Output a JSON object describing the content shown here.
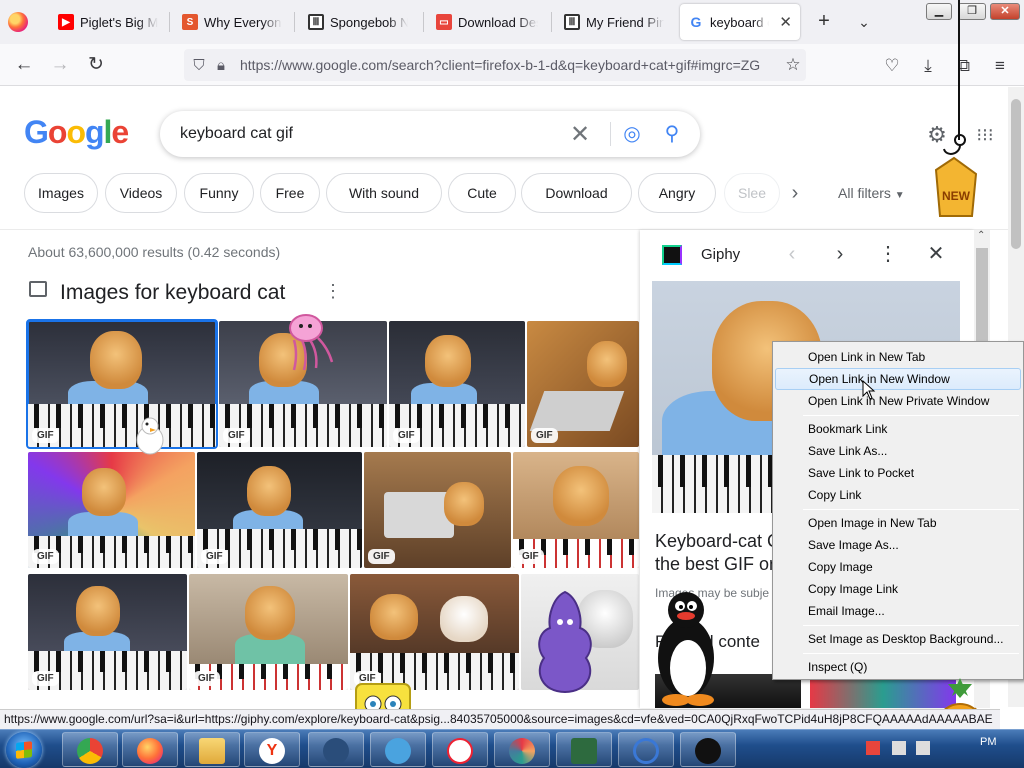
{
  "browser": {
    "tabs": [
      {
        "title": "Piglet's Big Mo",
        "favicon": "youtube-icon",
        "color": "#ff0000"
      },
      {
        "title": "Why Everyone S",
        "favicon": "s-icon",
        "color": "#e4572e"
      },
      {
        "title": "Spongebob Nic",
        "favicon": "museum-icon",
        "color": "#333333"
      },
      {
        "title": "Download Desk",
        "favicon": "download-site-icon",
        "color": "#e8453c"
      },
      {
        "title": "My Friend Ping",
        "favicon": "museum-icon",
        "color": "#333333"
      },
      {
        "title": "keyboard cat",
        "favicon": "google-icon",
        "color": "#4285f4",
        "active": true
      }
    ],
    "new_tab": "+",
    "tab_list": "⌄",
    "url": "https://www.google.com/search?client=firefox-b-1-d&q=keyboard+cat+gif#imgrc=ZG"
  },
  "search": {
    "logo": [
      "G",
      "o",
      "o",
      "g",
      "l",
      "e"
    ],
    "logo_colors": [
      "#4285f4",
      "#ea4335",
      "#fbbc05",
      "#4285f4",
      "#34a853",
      "#ea4335"
    ],
    "query": "keyboard cat gif",
    "chips": [
      "Images",
      "Videos",
      "Funny",
      "Free",
      "With sound",
      "Cute",
      "Download",
      "Angry",
      "Slee"
    ],
    "all_filters": "All filters",
    "stats": "About 63,600,000 results (0.42 seconds)",
    "images_heading": "Images for keyboard cat",
    "gif_badge": "GIF"
  },
  "panel": {
    "source": "Giphy",
    "title": "Keyboard-cat G\nthe best GIF on",
    "subtitle": "Images may be subje",
    "related": "Related conte"
  },
  "context_menu": {
    "items": [
      "Open Link in New Tab",
      "Open Link in New Window",
      "Open Link in New Private Window",
      "Bookmark Link",
      "Save Link As...",
      "Save Link to Pocket",
      "Copy Link",
      "Open Image in New Tab",
      "Save Image As...",
      "Copy Image",
      "Copy Image Link",
      "Email Image...",
      "Set Image as Desktop Background...",
      "Inspect (Q)"
    ],
    "highlighted": "Open Link in New Window"
  },
  "status_url": "https://www.google.com/url?sa=i&url=https://giphy.com/explore/keyboard-cat&psig...84035705000&source=images&cd=vfe&ved=0CA0QjRxqFwoTCPid4uH8jP8CFQAAAAAdAAAAABAE",
  "stickers": {
    "new_badge": "NEW"
  },
  "taskbar": {
    "clock": "PM"
  }
}
